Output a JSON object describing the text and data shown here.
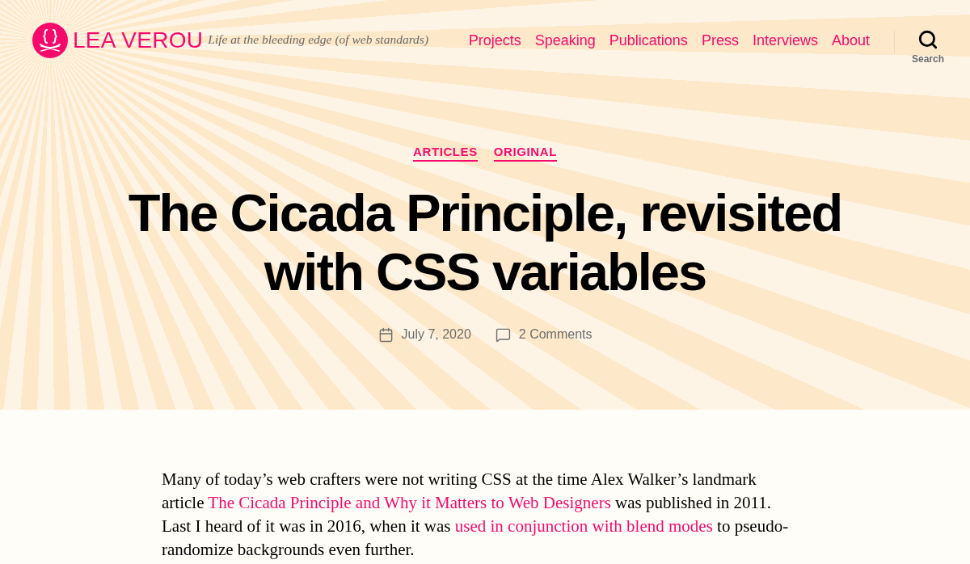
{
  "header": {
    "site_title": "LEA VEROU",
    "tagline": "Life at the bleeding edge (of web standards)",
    "nav": [
      {
        "label": "Projects"
      },
      {
        "label": "Speaking"
      },
      {
        "label": "Publications"
      },
      {
        "label": "Press"
      },
      {
        "label": "Interviews"
      },
      {
        "label": "About"
      }
    ],
    "search": {
      "label": "Search"
    }
  },
  "post": {
    "categories": [
      "ARTICLES",
      "ORIGINAL"
    ],
    "title": "The Cicada Principle, revisited with CSS variables",
    "date": "July 7, 2020",
    "comments": "2 Comments"
  },
  "content": {
    "paragraphs": [
      [
        {
          "kind": "text",
          "text": "Many of today’s web crafters were not writing CSS at the time Alex Walker’s landmark article "
        },
        {
          "kind": "link",
          "text": "The Cicada Principle and Why it Matters to Web Designers"
        },
        {
          "kind": "text",
          "text": " was published in 2011. Last I heard of it was in 2016, when it was "
        },
        {
          "kind": "link",
          "text": "used in conjunction with blend modes"
        },
        {
          "kind": "text",
          "text": " to pseudo-randomize backgrounds even further."
        }
      ]
    ]
  }
}
